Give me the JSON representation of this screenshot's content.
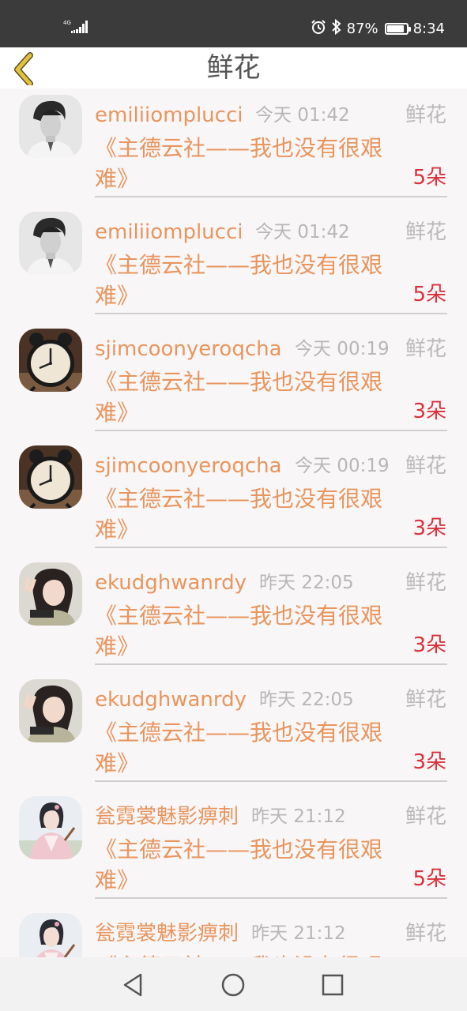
{
  "status_bar": {
    "network_type": "4G",
    "battery_percent_text": "87%",
    "battery_level": 0.87,
    "time": "8:34",
    "icons": [
      "signal-icon",
      "alarm-icon",
      "bluetooth-icon",
      "battery-icon"
    ]
  },
  "header": {
    "title": "鲜花",
    "back_icon": "chevron-left-icon"
  },
  "colors": {
    "status_bar_bg": "#3b3b3b",
    "accent_orange": "#e8955e",
    "count_red": "#d9313b",
    "back_icon_yellow": "#e2c43a",
    "muted_text": "#b7b7b7"
  },
  "items": [
    {
      "username": "emiliiomplucci",
      "time": "今天 01:42",
      "type": "鲜花",
      "work": "《主德云社——我也没有很艰难》",
      "count": "5朵",
      "avatar": "portrait-man-bw"
    },
    {
      "username": "emiliiomplucci",
      "time": "今天 01:42",
      "type": "鲜花",
      "work": "《主德云社——我也没有很艰难》",
      "count": "5朵",
      "avatar": "portrait-man-bw"
    },
    {
      "username": "sjimcoonyeroqcha",
      "time": "今天 00:19",
      "type": "鲜花",
      "work": "《主德云社——我也没有很艰难》",
      "count": "3朵",
      "avatar": "alarm-clock"
    },
    {
      "username": "sjimcoonyeroqcha",
      "time": "今天 00:19",
      "type": "鲜花",
      "work": "《主德云社——我也没有很艰难》",
      "count": "3朵",
      "avatar": "alarm-clock"
    },
    {
      "username": "ekudghwanrdy",
      "time": "昨天 22:05",
      "type": "鲜花",
      "work": "《主德云社——我也没有很艰难》",
      "count": "3朵",
      "avatar": "girl-peace-sign"
    },
    {
      "username": "ekudghwanrdy",
      "time": "昨天 22:05",
      "type": "鲜花",
      "work": "《主德云社——我也没有很艰难》",
      "count": "3朵",
      "avatar": "girl-peace-sign"
    },
    {
      "username": "瓮霓裳魅影痹刺",
      "time": "昨天 21:12",
      "type": "鲜花",
      "work": "《主德云社——我也没有很艰难》",
      "count": "5朵",
      "avatar": "girl-hanfu"
    },
    {
      "username": "瓮霓裳魅影痹刺",
      "time": "昨天 21:12",
      "type": "鲜花",
      "work": "《主德云社——我也没有很艰难》",
      "count": "",
      "avatar": "girl-hanfu"
    }
  ],
  "nav_bar": {
    "buttons": [
      "back-triangle-icon",
      "home-circle-icon",
      "recents-square-icon"
    ]
  }
}
